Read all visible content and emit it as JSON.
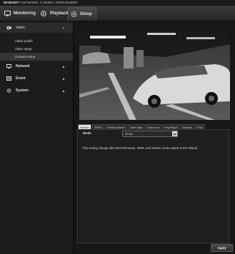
{
  "brand": {
    "prefix": "WISENET",
    "text": "NETWORK CAMERA WEBVIEWER"
  },
  "nav": {
    "monitoring": "Monitoring",
    "playback": "Playback",
    "setup": "Setup"
  },
  "sidebar": {
    "video": "Video",
    "video_sub": [
      "Video profile",
      "Video setup",
      "Camera setup"
    ],
    "network": "Network",
    "event": "Event",
    "system": "System"
  },
  "camera_tabs": [
    "Sensor",
    "SSDR",
    "White balance",
    "Back light",
    "Exposure",
    "Day/Night",
    "Special",
    "OSD"
  ],
  "sensor": {
    "mode_label": "Mode",
    "mode_value": "30 fps",
    "note": "This setting change will reset Framerate, WDR, and Shutter mode values to the default."
  },
  "apply_label": "Apply",
  "colors": {
    "accent": "#e6e6e6",
    "background": "#151515"
  }
}
